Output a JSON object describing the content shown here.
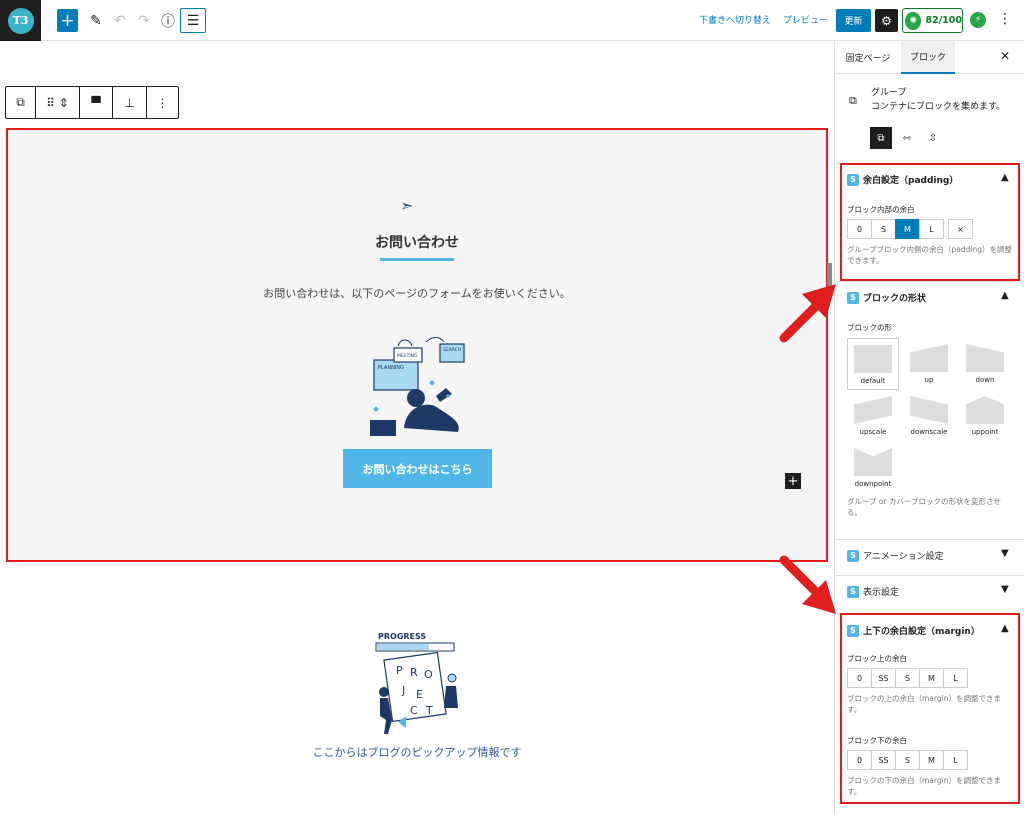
{
  "logo_text": "T3",
  "topbar": {
    "switch_draft": "下書きへ切り替え",
    "preview": "プレビュー",
    "update": "更新",
    "score": "82/100"
  },
  "content": {
    "title": "お問い合わせ",
    "text": "お問い合わせは、以下のページのフォームをお使いください。",
    "button": "お問い合わせはこちら",
    "illus1_labels": [
      "PLANNING",
      "MEETING",
      "SEARCH"
    ],
    "illus2_label": "PROGRESS",
    "illus2_letters": [
      "P",
      "R",
      "O",
      "J",
      "E",
      "C",
      "T"
    ],
    "pickup": "ここからはブログのピックアップ情報です"
  },
  "sidebar": {
    "tab_page": "固定ページ",
    "tab_block": "ブロック",
    "block_name": "グループ",
    "block_desc": "コンテナにブロックを集めます。",
    "padding": {
      "title": "余白設定（padding）",
      "label": "ブロック内部の余白",
      "options": [
        "0",
        "S",
        "M",
        "L",
        "×"
      ],
      "help": "グループブロック内側の余白（padding）を調整できます。"
    },
    "shape": {
      "title": "ブロックの形状",
      "label": "ブロックの形",
      "options": [
        "default",
        "up",
        "down",
        "upscale",
        "downscale",
        "uppoint",
        "downpoint"
      ],
      "help": "グループ or カバーブロックの形状を変形させる。"
    },
    "animation": {
      "title": "アニメーション設定"
    },
    "display": {
      "title": "表示設定"
    },
    "margin": {
      "title": "上下の余白設定（margin）",
      "top_label": "ブロック上の余白",
      "top_options": [
        "0",
        "SS",
        "S",
        "M",
        "L"
      ],
      "top_help": "ブロックの上の余白（margin）を調整できます。",
      "bottom_label": "ブロック下の余白",
      "bottom_options": [
        "0",
        "SS",
        "S",
        "M",
        "L"
      ],
      "bottom_help": "ブロックの下の余白（margin）を調整できます。"
    }
  },
  "colors": {
    "accent": "#007cba",
    "brand": "#52b7e6",
    "highlight": "#e01e1e"
  }
}
